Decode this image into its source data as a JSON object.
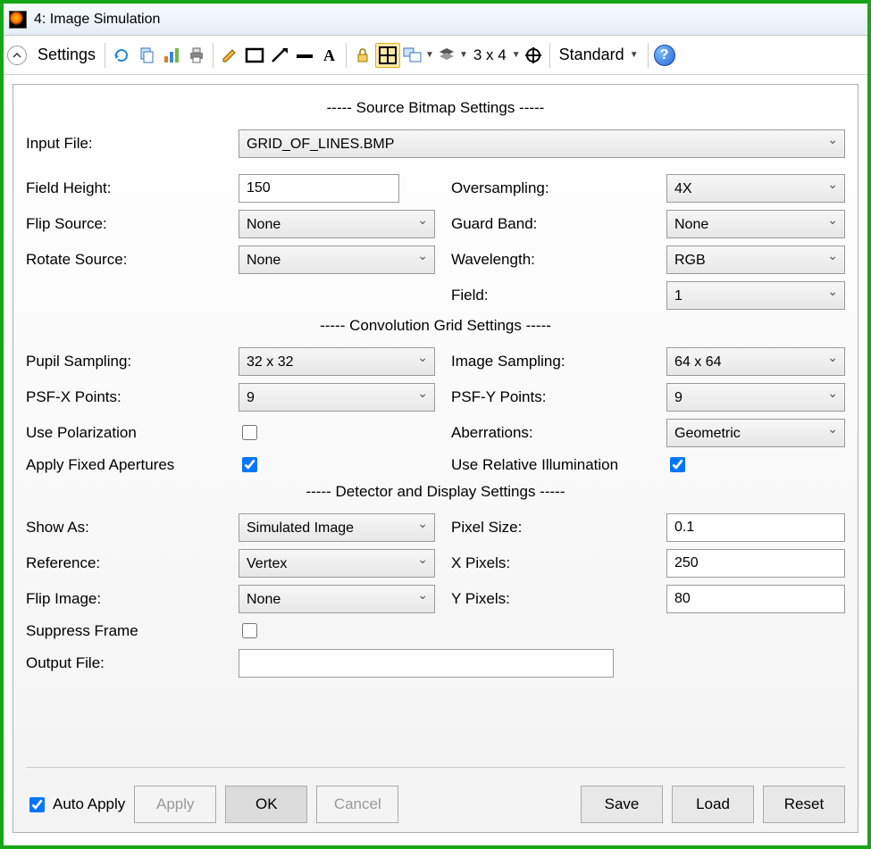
{
  "window": {
    "title": "4: Image Simulation"
  },
  "toolbar": {
    "settings_label": "Settings",
    "grid_label": "3 x 4",
    "mode_label": "Standard"
  },
  "sections": {
    "source": "----- Source Bitmap Settings -----",
    "convolution": "----- Convolution Grid Settings -----",
    "detector": "----- Detector and Display Settings -----"
  },
  "labels": {
    "input_file": "Input File:",
    "field_height": "Field Height:",
    "flip_source": "Flip Source:",
    "rotate_source": "Rotate Source:",
    "oversampling": "Oversampling:",
    "guard_band": "Guard Band:",
    "wavelength": "Wavelength:",
    "field": "Field:",
    "pupil_sampling": "Pupil Sampling:",
    "psf_x": "PSF-X Points:",
    "psf_y": "PSF-Y Points:",
    "image_sampling": "Image Sampling:",
    "use_polarization": "Use Polarization",
    "aberrations": "Aberrations:",
    "apply_fixed_apertures": "Apply Fixed Apertures",
    "use_relative_illumination": "Use Relative Illumination",
    "show_as": "Show As:",
    "reference": "Reference:",
    "flip_image": "Flip Image:",
    "pixel_size": "Pixel Size:",
    "x_pixels": "X Pixels:",
    "y_pixels": "Y Pixels:",
    "suppress_frame": "Suppress Frame",
    "output_file": "Output File:"
  },
  "values": {
    "input_file": "GRID_OF_LINES.BMP",
    "field_height": "150",
    "flip_source": "None",
    "rotate_source": "None",
    "oversampling": "4X",
    "guard_band": "None",
    "wavelength": "RGB",
    "field": "1",
    "pupil_sampling": "32 x 32",
    "image_sampling": "64 x 64",
    "psf_x": "9",
    "psf_y": "9",
    "use_polarization": false,
    "aberrations": "Geometric",
    "apply_fixed_apertures": true,
    "use_relative_illumination": true,
    "show_as": "Simulated Image",
    "reference": "Vertex",
    "flip_image": "None",
    "pixel_size": "0.1",
    "x_pixels": "250",
    "y_pixels": "80",
    "suppress_frame": false,
    "output_file": "",
    "auto_apply": true
  },
  "footer": {
    "auto_apply": "Auto Apply",
    "apply": "Apply",
    "ok": "OK",
    "cancel": "Cancel",
    "save": "Save",
    "load": "Load",
    "reset": "Reset"
  }
}
